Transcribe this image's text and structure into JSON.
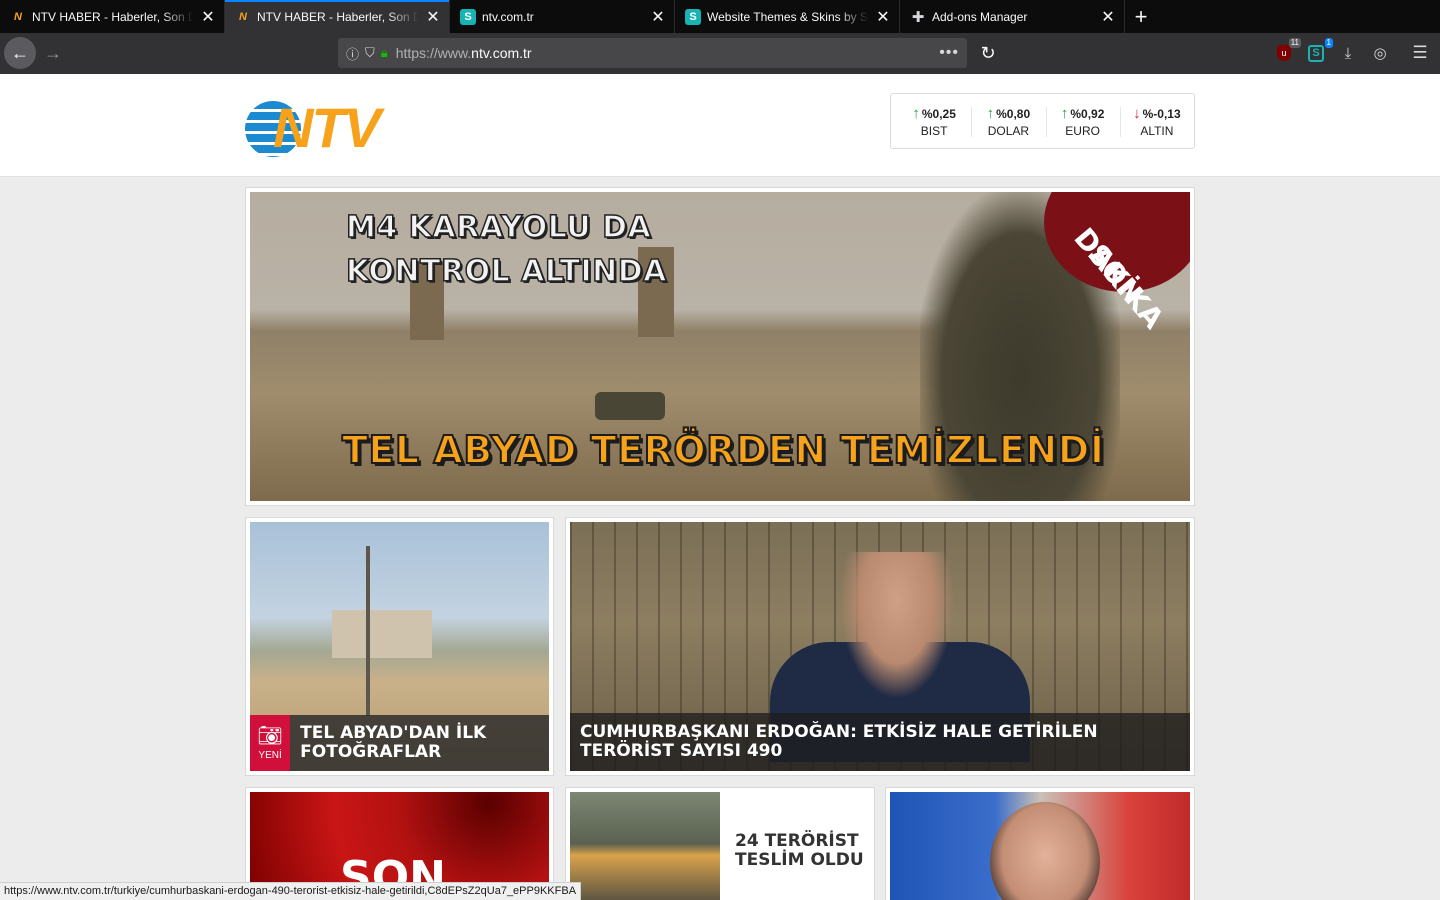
{
  "browser": {
    "tabs": [
      {
        "title": "NTV HABER - Haberler, Son Dakika",
        "favicon": "ntv-icon",
        "active": false
      },
      {
        "title": "NTV HABER - Haberler, Son Dakika",
        "favicon": "ntv-icon",
        "active": true
      },
      {
        "title": "ntv.com.tr",
        "favicon": "stylus-icon",
        "active": false
      },
      {
        "title": "Website Themes & Skins by Stylish",
        "favicon": "stylus-icon",
        "active": false
      },
      {
        "title": "Add-ons Manager",
        "favicon": "puzzle-icon",
        "active": false
      }
    ],
    "url_prefix": "https://www.",
    "url_domain": "ntv.com.tr",
    "page_actions": "•••",
    "extensions": {
      "ublock_badge": "11",
      "stylus_badge": "1"
    },
    "status_url": "https://www.ntv.com.tr/turkiye/cumhurbaskani-erdogan-490-terorist-etkisiz-hale-getirildi,C8dEPsZ2qUa7_ePP9KKFBA"
  },
  "site": {
    "logo_text": "NTV",
    "market": [
      {
        "value": "%0,25",
        "label": "BIST",
        "direction": "up"
      },
      {
        "value": "%0,80",
        "label": "DOLAR",
        "direction": "up"
      },
      {
        "value": "%0,92",
        "label": "EURO",
        "direction": "up"
      },
      {
        "value": "%-0,13",
        "label": "ALTIN",
        "direction": "down"
      }
    ]
  },
  "hero": {
    "headline_line1": "M4 KARAYOLU DA",
    "headline_line2": "KONTROL ALTINDA",
    "banner": "TEL ABYAD TERÖRDEN TEMİZLENDİ",
    "badge_line1": "SON",
    "badge_line2": "DAKİKA"
  },
  "stories": [
    {
      "title": "TEL ABYAD'DAN İLK FOTOĞRAFLAR",
      "badge": "YENİ"
    },
    {
      "title": "CUMHURBAŞKANI ERDOĞAN: ETKİSİZ HALE GETİRİLEN TERÖRİST SAYISI 490"
    },
    {
      "title": "SON"
    },
    {
      "title": "24 TERÖRİST TESLİM OLDU"
    }
  ],
  "colors": {
    "brand_orange": "#f7a21b",
    "brand_blue": "#1b8ad1",
    "up": "#20a53b",
    "down": "#e21f32",
    "photo_badge": "#d0103a"
  }
}
